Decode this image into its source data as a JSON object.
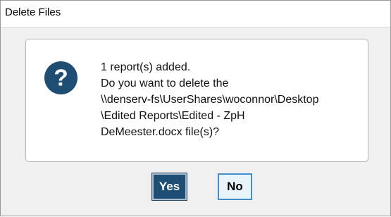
{
  "window": {
    "title": "Delete Files"
  },
  "icon": {
    "name": "question-icon",
    "glyph": "?",
    "color": "#1f4e74"
  },
  "message": {
    "lines": [
      "1 report(s) added.",
      "Do you want to delete the",
      "\\\\denserv-fs\\UserShares\\woconnor\\Desktop",
      "\\Edited Reports\\Edited - ZpH",
      "DeMeester.docx file(s)?"
    ]
  },
  "buttons": {
    "yes_label": "Yes",
    "no_label": "No"
  },
  "colors": {
    "primary_button": "#1f4e74",
    "secondary_button_border": "#3f8fd1",
    "dialog_background": "#f0f0f0"
  }
}
